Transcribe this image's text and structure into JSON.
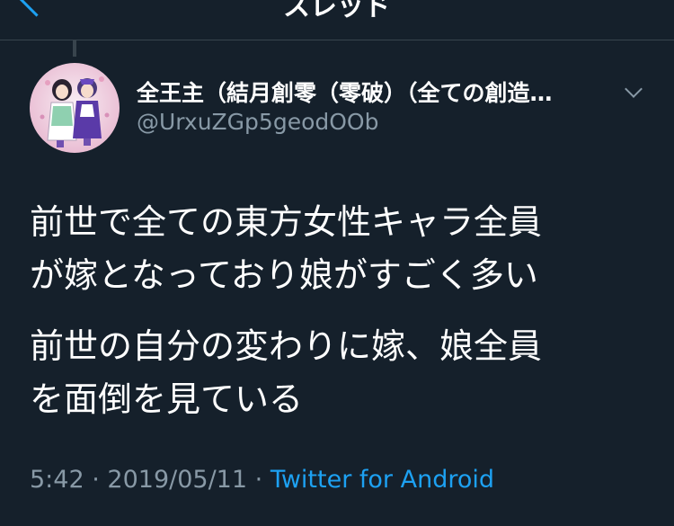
{
  "header": {
    "title": "スレッド",
    "back_icon": "chevron-left-icon"
  },
  "tweet": {
    "avatar_icon": "avatar-anime-characters",
    "display_name": "全王主（結月創零（零破）（全ての創造…",
    "handle": "@UrxuZGp5geodOOb",
    "more_icon": "chevron-down-icon",
    "text_lines": [
      "前世で全ての東方女性キャラ全員",
      "が嫁となっており娘がすごく多い",
      "前世の自分の変わりに嫁、娘全員",
      "を面倒を見ている"
    ],
    "time": "5:42",
    "separator": "·",
    "date": "2019/05/11",
    "source": "Twitter for Android"
  },
  "colors": {
    "background": "#15202b",
    "accent": "#1da1f2",
    "secondary_text": "#8899a6",
    "divider": "#38444d"
  }
}
